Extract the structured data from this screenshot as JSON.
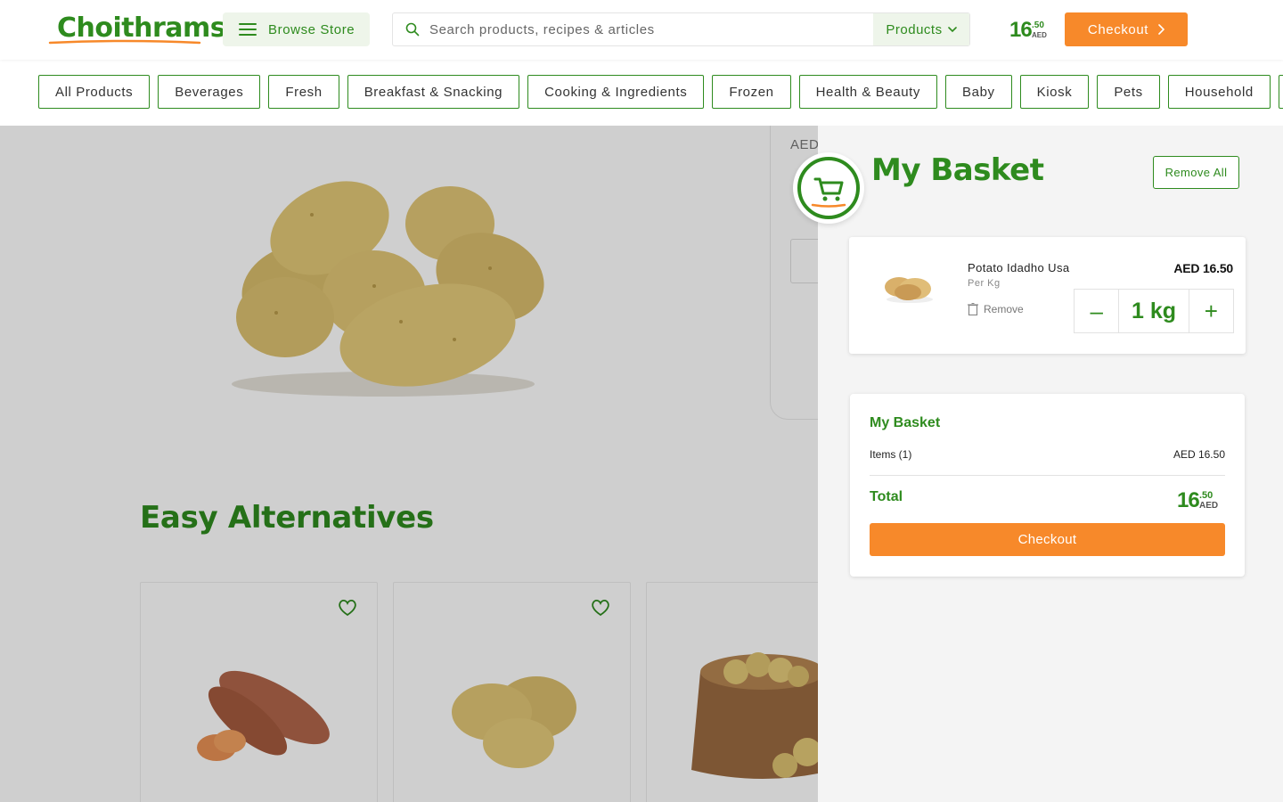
{
  "header": {
    "logo_text": "Choithrams",
    "browse_label": "Browse Store",
    "search_placeholder": "Search products, recipes & articles",
    "search_scope": "Products",
    "basket_total": {
      "integer": "16",
      "decimal": ".50",
      "currency": "AED"
    },
    "checkout_label": "Checkout"
  },
  "categories": [
    "All Products",
    "Beverages",
    "Fresh",
    "Breakfast & Snacking",
    "Cooking & Ingredients",
    "Frozen",
    "Health & Beauty",
    "Baby",
    "Kiosk",
    "Pets",
    "Household"
  ],
  "product_page": {
    "price_currency_label": "AED",
    "alternatives_title": "Easy Alternatives"
  },
  "basket": {
    "title": "My Basket",
    "remove_all_label": "Remove All",
    "items": [
      {
        "name": "Potato Idadho Usa",
        "unit": "Per Kg",
        "remove_label": "Remove",
        "price": "AED 16.50",
        "quantity": "1 kg",
        "decrement_symbol": "–",
        "increment_symbol": "+"
      }
    ],
    "summary": {
      "title": "My Basket",
      "items_label": "Items (1)",
      "items_value": "AED 16.50",
      "total_label": "Total",
      "total": {
        "integer": "16",
        "decimal": ".50",
        "currency": "AED"
      },
      "checkout_label": "Checkout"
    }
  },
  "colors": {
    "brand_green": "#2e8b1e",
    "accent_orange": "#f7892a",
    "light_green_bg": "#eef5ea"
  },
  "icons": [
    "menu-icon",
    "search-icon",
    "chevron-down-icon",
    "chevron-right-icon",
    "basket-icon",
    "trash-icon",
    "heart-icon"
  ]
}
